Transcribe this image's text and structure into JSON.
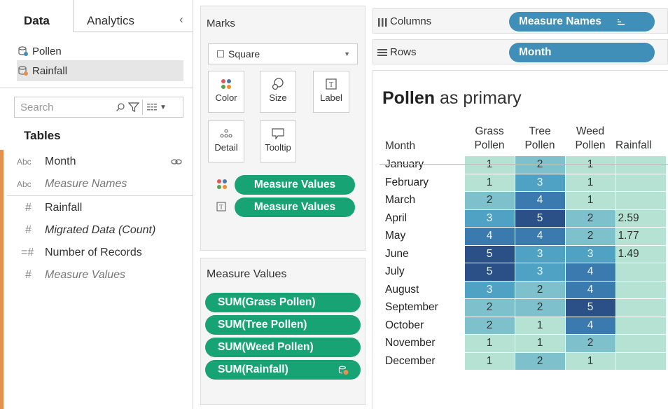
{
  "left_panel": {
    "tabs": [
      "Data",
      "Analytics"
    ],
    "collapse_glyph": "‹",
    "datasources": [
      "Pollen",
      "Rainfall"
    ],
    "search": {
      "placeholder": "Search"
    },
    "tables_heading": "Tables",
    "dimensions": [
      {
        "type": "Abc",
        "name": "Month",
        "link_icon": "link-icon"
      },
      {
        "type": "Abc",
        "name": "Measure Names"
      }
    ],
    "measures": [
      {
        "type": "#",
        "name": "Rainfall"
      },
      {
        "type": "#",
        "name": "Migrated Data (Count)"
      },
      {
        "type": "=#",
        "name": "Number of Records"
      },
      {
        "type": "#",
        "name": "Measure Values"
      }
    ]
  },
  "marks": {
    "title": "Marks",
    "mark_type": "Square",
    "buttons": [
      "Color",
      "Size",
      "Label",
      "Detail",
      "Tooltip"
    ],
    "pills": [
      "Measure Values",
      "Measure Values"
    ]
  },
  "measure_values_card": {
    "title": "Measure Values",
    "pills": [
      "SUM(Grass Pollen)",
      "SUM(Tree Pollen)",
      "SUM(Weed Pollen)",
      "SUM(Rainfall)"
    ]
  },
  "shelves": {
    "columns_label": "Columns",
    "columns_pill": "Measure Names",
    "rows_label": "Rows",
    "rows_pill": "Month"
  },
  "view": {
    "title_bold": "Pollen",
    "title_rest": " as primary",
    "row_header": "Month",
    "columns": [
      "Grass Pollen",
      "Tree Pollen",
      "Weed Pollen",
      "Rainfall"
    ],
    "rows": [
      {
        "month": "January",
        "grass": "1",
        "tree": "2",
        "weed": "1",
        "rain": ""
      },
      {
        "month": "February",
        "grass": "1",
        "tree": "3",
        "weed": "1",
        "rain": ""
      },
      {
        "month": "March",
        "grass": "2",
        "tree": "4",
        "weed": "1",
        "rain": ""
      },
      {
        "month": "April",
        "grass": "3",
        "tree": "5",
        "weed": "2",
        "rain": "2.59"
      },
      {
        "month": "May",
        "grass": "4",
        "tree": "4",
        "weed": "2",
        "rain": "1.77"
      },
      {
        "month": "June",
        "grass": "5",
        "tree": "3",
        "weed": "3",
        "rain": "1.49"
      },
      {
        "month": "July",
        "grass": "5",
        "tree": "3",
        "weed": "4",
        "rain": ""
      },
      {
        "month": "August",
        "grass": "3",
        "tree": "2",
        "weed": "4",
        "rain": ""
      },
      {
        "month": "September",
        "grass": "2",
        "tree": "2",
        "weed": "5",
        "rain": ""
      },
      {
        "month": "October",
        "grass": "2",
        "tree": "1",
        "weed": "4",
        "rain": ""
      },
      {
        "month": "November",
        "grass": "1",
        "tree": "1",
        "weed": "2",
        "rain": ""
      },
      {
        "month": "December",
        "grass": "1",
        "tree": "2",
        "weed": "1",
        "rain": ""
      }
    ],
    "color_scale": {
      "1": "#b5e2d3",
      "2": "#7ec1cc",
      "3": "#4fa2c3",
      "4": "#3b7aae",
      "5": "#2b5087"
    },
    "rain_cell_color": "#b5e2d3"
  },
  "colors": {
    "green_pill": "#18a374",
    "blue_pill": "#3f8fb9",
    "accent_bar": "#e7904c"
  }
}
